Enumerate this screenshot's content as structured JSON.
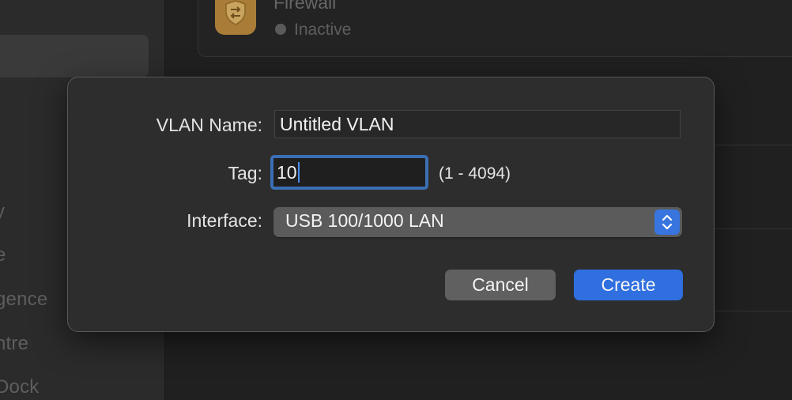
{
  "background": {
    "sidebar_items": [
      "y",
      "e",
      "gence",
      "ntre",
      "Dock"
    ],
    "firewall": {
      "title": "Firewall",
      "status": "Inactive",
      "icon": "firewall-shield-icon"
    }
  },
  "dialog": {
    "vlan_name_label": "VLAN Name:",
    "vlan_name_value": "Untitled VLAN",
    "tag_label": "Tag:",
    "tag_value": "10",
    "tag_range": "(1 - 4094)",
    "interface_label": "Interface:",
    "interface_value": "USB 100/1000 LAN",
    "cancel_label": "Cancel",
    "create_label": "Create"
  },
  "colors": {
    "accent": "#2f6fe0",
    "focus_ring": "#3a6fb5",
    "firewall_icon": "#a97d37"
  }
}
